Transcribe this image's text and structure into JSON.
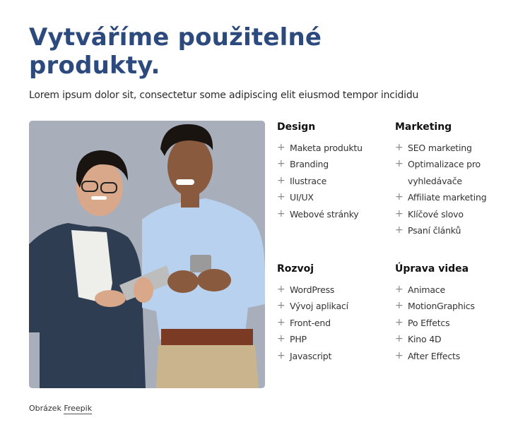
{
  "hero": {
    "title": "Vytváříme použitelné produkty.",
    "subtitle": "Lorem ipsum dolor sit, consectetur some adipiscing elit eiusmod tempor incididu"
  },
  "image": {
    "alt": "Two smiling people holding a tablet and a phone",
    "colors": {
      "background": "#a9aebb",
      "jacket": "#2f3d52",
      "shirt": "#b7d1ef",
      "skin_left": "#d9a88a",
      "skin_right": "#8a5a3e",
      "hair": "#1a1411",
      "belt": "#7a3a24",
      "pants": "#c9b48e"
    }
  },
  "plus_icon": "plus-icon",
  "columns": [
    {
      "heading": "Design",
      "items": [
        "Maketa produktu",
        "Branding",
        "Ilustrace",
        "UI/UX",
        "Webové stránky"
      ]
    },
    {
      "heading": "Marketing",
      "items": [
        "SEO marketing",
        "Optimalizace pro vyhledávače",
        "Affiliate marketing",
        "Klíčové slovo",
        "Psaní článků"
      ]
    },
    {
      "heading": "Rozvoj",
      "items": [
        "WordPress",
        "Vývoj aplikací",
        "Front-end",
        "PHP",
        "Javascript"
      ]
    },
    {
      "heading": "Úprava videa",
      "items": [
        "Animace",
        "MotionGraphics",
        "Po Effetcs",
        "Kino 4D",
        "After Effects"
      ]
    }
  ],
  "credit": {
    "prefix": "Obrázek",
    "link": "Freepik"
  },
  "colors": {
    "title": "#2c4a7d",
    "text": "#333333",
    "plus": "#8a8a8a"
  }
}
